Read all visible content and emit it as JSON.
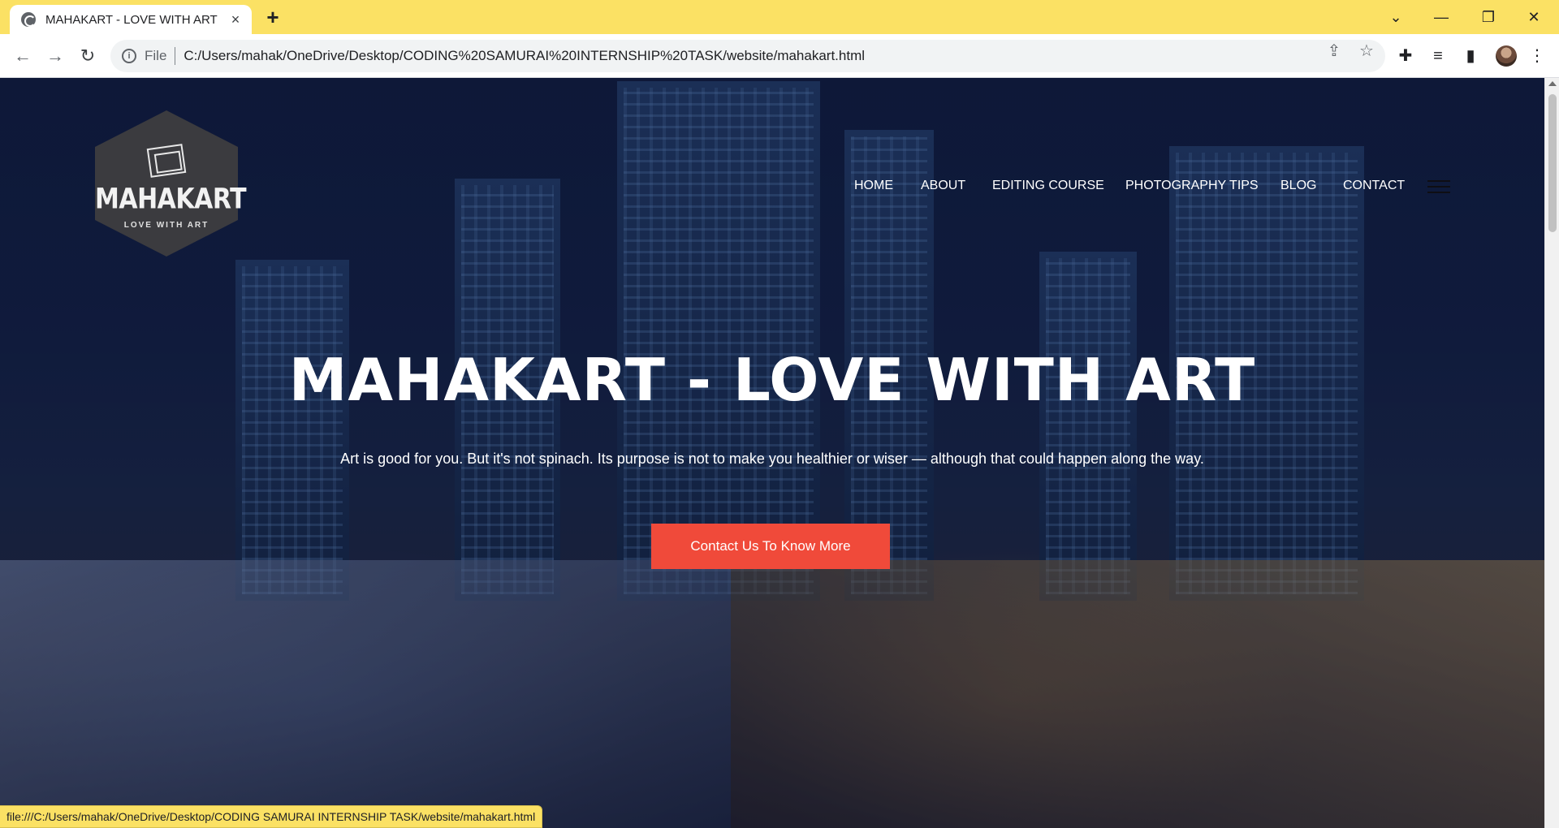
{
  "browser": {
    "tab_title": "MAHAKART - LOVE WITH ART",
    "tab_close_icon": "×",
    "new_tab_icon": "+",
    "file_label": "File",
    "url": "C:/Users/mahak/OneDrive/Desktop/CODING%20SAMURAI%20INTERNSHIP%20TASK/website/mahakart.html",
    "status_url": "file:///C:/Users/mahak/OneDrive/Desktop/CODING SAMURAI INTERNSHIP TASK/website/mahakart.html"
  },
  "site": {
    "logo": {
      "brand": "MAHAKART",
      "tagline": "LOVE WITH ART"
    },
    "nav": [
      {
        "label": "HOME"
      },
      {
        "label": "ABOUT"
      },
      {
        "label": "EDITING COURSE"
      },
      {
        "label": "PHOTOGRAPHY TIPS"
      },
      {
        "label": "BLOG"
      },
      {
        "label": "CONTACT"
      }
    ],
    "hero": {
      "title": "MAHAKART - LOVE WITH ART",
      "subtitle": "Art is good for you. But it's not spinach. Its purpose is not to make you healthier or wiser — although that could happen along the way.",
      "cta_label": "Contact Us To Know More"
    }
  },
  "colors": {
    "tabstrip": "#fbe164",
    "cta": "#f04a3a",
    "logo_bg": "#3b3b3f"
  }
}
